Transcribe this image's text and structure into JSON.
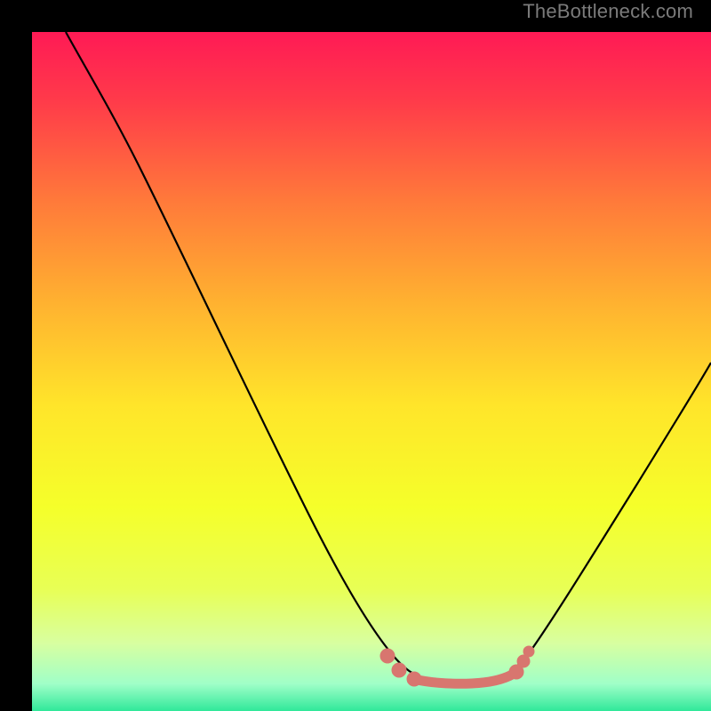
{
  "watermark": "TheBottleneck.com",
  "chart_data": {
    "type": "line",
    "title": "",
    "xlabel": "",
    "ylabel": "",
    "xlim": [
      0,
      100
    ],
    "ylim": [
      0,
      100
    ],
    "grid": false,
    "legend": false,
    "background_gradient": {
      "stops": [
        {
          "offset": 0.0,
          "color": "#ff1a55"
        },
        {
          "offset": 0.1,
          "color": "#ff3a4a"
        },
        {
          "offset": 0.25,
          "color": "#ff7a3a"
        },
        {
          "offset": 0.4,
          "color": "#ffb230"
        },
        {
          "offset": 0.55,
          "color": "#ffe52a"
        },
        {
          "offset": 0.7,
          "color": "#f5ff2a"
        },
        {
          "offset": 0.82,
          "color": "#e8ff55"
        },
        {
          "offset": 0.9,
          "color": "#d8ffa0"
        },
        {
          "offset": 0.96,
          "color": "#a0ffc8"
        },
        {
          "offset": 1.0,
          "color": "#30e89a"
        }
      ]
    },
    "series": [
      {
        "name": "bottleneck-curve",
        "color": "#000000",
        "x": [
          5,
          10,
          15,
          20,
          25,
          30,
          35,
          40,
          45,
          50,
          52,
          55,
          58,
          62,
          66,
          70,
          72,
          75,
          80,
          85,
          90,
          95,
          100
        ],
        "y": [
          100,
          92,
          83,
          74,
          65,
          56,
          47,
          38,
          29,
          20,
          14,
          10,
          7,
          5,
          5,
          6,
          8,
          12,
          20,
          30,
          40,
          48,
          55
        ]
      },
      {
        "name": "optimal-range-marker",
        "color": "#d8766f",
        "style": "dots-and-segment",
        "x": [
          52,
          54,
          58,
          62,
          66,
          70,
          72
        ],
        "y": [
          13,
          10,
          6,
          5,
          5,
          6,
          9
        ]
      }
    ],
    "annotations": []
  }
}
